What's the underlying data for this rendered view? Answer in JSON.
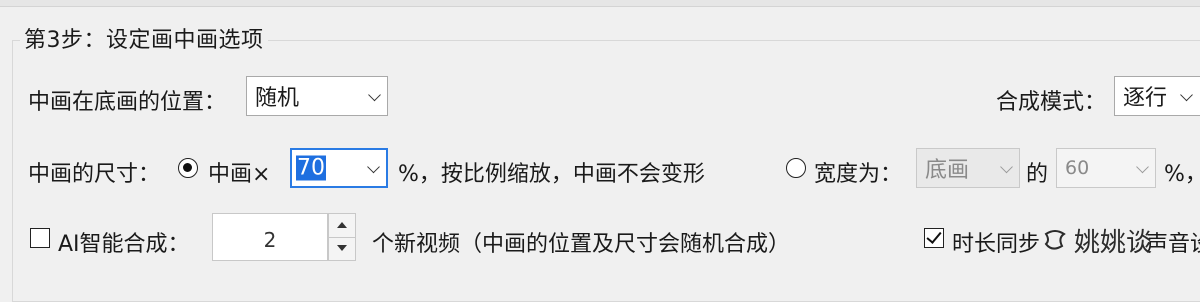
{
  "step_group": {
    "title": "第3步：设定画中画选项"
  },
  "position_row": {
    "label": "中画在底画的位置：",
    "position_value": "随机",
    "mode_label": "合成模式：",
    "mode_value": "逐行"
  },
  "size_row": {
    "label": "中画的尺寸：",
    "scale_radio_label": "中画×",
    "scale_radio_checked": true,
    "scale_value": "70",
    "scale_suffix": "%，按比例缩放，中画不会变形",
    "width_radio_label": "宽度为：",
    "width_radio_checked": false,
    "width_ref_value": "底画",
    "of_label": "的",
    "width_percent_value": "60",
    "width_percent_suffix": "%，"
  },
  "ai_row": {
    "ai_checkbox_label": "AI智能合成：",
    "ai_checked": false,
    "count_value": "2",
    "count_suffix": "个新视频（中画的位置及尺寸会随机合成）",
    "duration_sync_label": "时长同步",
    "duration_sync_checked": true,
    "audio_label": "声音设"
  },
  "watermark": {
    "text": "姚姚谈"
  },
  "colors": {
    "background": "#f0f0f0",
    "focus_border": "#2a7be4",
    "selection": "#1e6fe0"
  }
}
